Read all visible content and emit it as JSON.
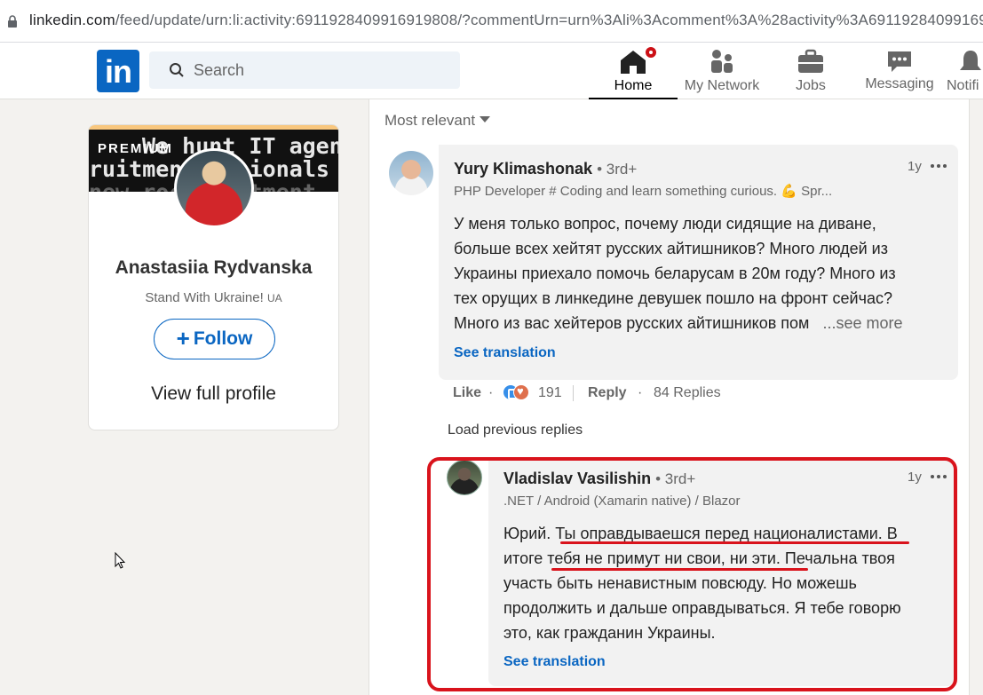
{
  "browser": {
    "url_main": "linkedin.com",
    "url_path": "/feed/update/urn:li:activity:6911928409916919808/?commentUrn=urn%3Ali%3Acomment%3A%28activity%3A69119284099169"
  },
  "nav": {
    "logo": "in",
    "search_placeholder": "Search",
    "items": [
      {
        "label": "Home",
        "icon": "home-icon",
        "active": true
      },
      {
        "label": "My Network",
        "icon": "my-network-icon"
      },
      {
        "label": "Jobs",
        "icon": "jobs-icon"
      },
      {
        "label": "Messaging",
        "icon": "messaging-icon"
      },
      {
        "label": "Notifi",
        "icon": "notifications-icon"
      }
    ]
  },
  "profile_card": {
    "premium_label": "PREMIUM",
    "banner_line1": "We hunt IT agenc",
    "banner_line2": "ruitment  essionals",
    "banner_line3": "new rock  ruitment",
    "name": "Anastasiia Rydvanska",
    "tagline": "Stand With Ukraine!",
    "tagline_flag": "UA",
    "follow_label": "Follow",
    "view_profile_label": "View full profile"
  },
  "comments": {
    "sort_label": "Most relevant",
    "first": {
      "author": "Yury Klimashonak",
      "degree": "• 3rd+",
      "headline": "PHP Developer # Coding and learn something curious. 💪 Spr...",
      "time": "1y",
      "lines": [
        "У меня только вопрос, почему люди сидящие на диване,",
        "больше всех хейтят русских айтишников? Много людей из",
        "Украины приехало помочь беларусам в 20м году? Много из",
        "тех орущих в линкедине девушек пошло на фронт сейчас?",
        "Много из вас хейтеров русских айтишников пом"
      ],
      "see_more": "...see more",
      "see_translation": "See translation",
      "like_label": "Like",
      "reaction_count": "191",
      "reply_label": "Reply",
      "replies_label": "84 Replies"
    },
    "load_previous": "Load previous replies",
    "reply": {
      "author": "Vladislav Vasilishin",
      "degree": "• 3rd+",
      "headline": ".NET / Android (Xamarin native) / Blazor",
      "time": "1y",
      "lines": [
        "Юрий. Ты оправдываешся перед националистами. В",
        "итоге тебя не примут ни свои, ни эти. Печальна твоя",
        "участь быть ненавистным повсюду. Но можешь",
        "продолжить и дальше оправдываться. Я тебе говорю",
        "это, как гражданин Украины."
      ],
      "see_translation": "See translation"
    }
  },
  "colors": {
    "linkedin_blue": "#0a66c2",
    "highlight_red": "#d9131c",
    "background": "#f3f2ef"
  }
}
